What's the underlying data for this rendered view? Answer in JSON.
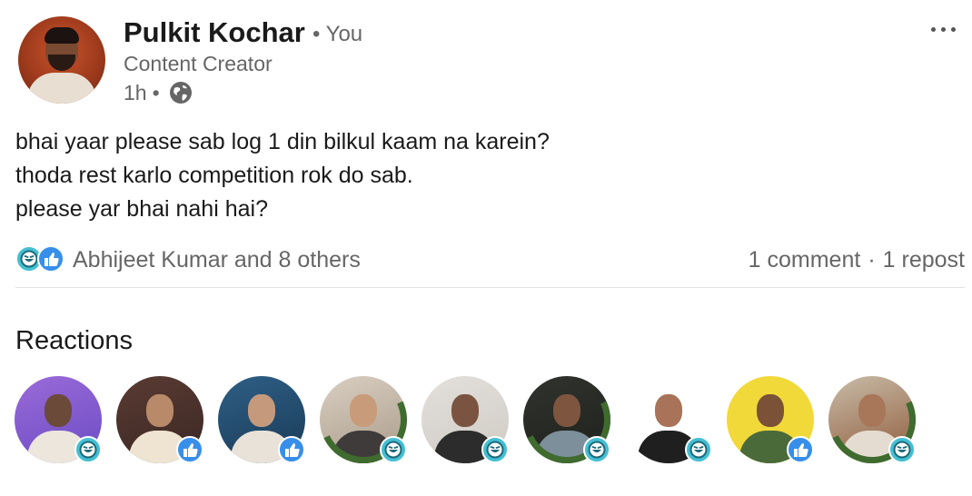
{
  "post": {
    "author": {
      "name": "Pulkit Kochar",
      "you_label": "• You",
      "headline": "Content Creator",
      "time": "1h",
      "time_separator": "•"
    },
    "text_lines": [
      "bhai yaar please sab log 1 din bilkul kaam na karein?",
      "thoda rest karlo competition rok do sab.",
      "please yar bhai nahi hai?"
    ],
    "reactors_summary": "Abhijeet Kumar and 8 others",
    "comments": "1 comment",
    "separator": "·",
    "reposts": "1 repost",
    "reactions_title": "Reactions",
    "reactions": [
      {
        "type": "funny",
        "icon": "laugh-reaction-icon"
      },
      {
        "type": "like",
        "icon": "like-reaction-icon"
      },
      {
        "type": "like",
        "icon": "like-reaction-icon"
      },
      {
        "type": "funny",
        "icon": "laugh-reaction-icon",
        "open_to_work": true
      },
      {
        "type": "funny",
        "icon": "laugh-reaction-icon"
      },
      {
        "type": "funny",
        "icon": "laugh-reaction-icon",
        "open_to_work": true
      },
      {
        "type": "funny",
        "icon": "laugh-reaction-icon"
      },
      {
        "type": "like",
        "icon": "like-reaction-icon"
      },
      {
        "type": "funny",
        "icon": "laugh-reaction-icon",
        "open_to_work": true
      }
    ]
  },
  "colors": {
    "text_primary": "#1a1a1a",
    "text_secondary": "#666666",
    "like_blue": "#378fe9",
    "funny_teal": "#44bfd3",
    "open_to_work_green": "#3f6b2f"
  }
}
